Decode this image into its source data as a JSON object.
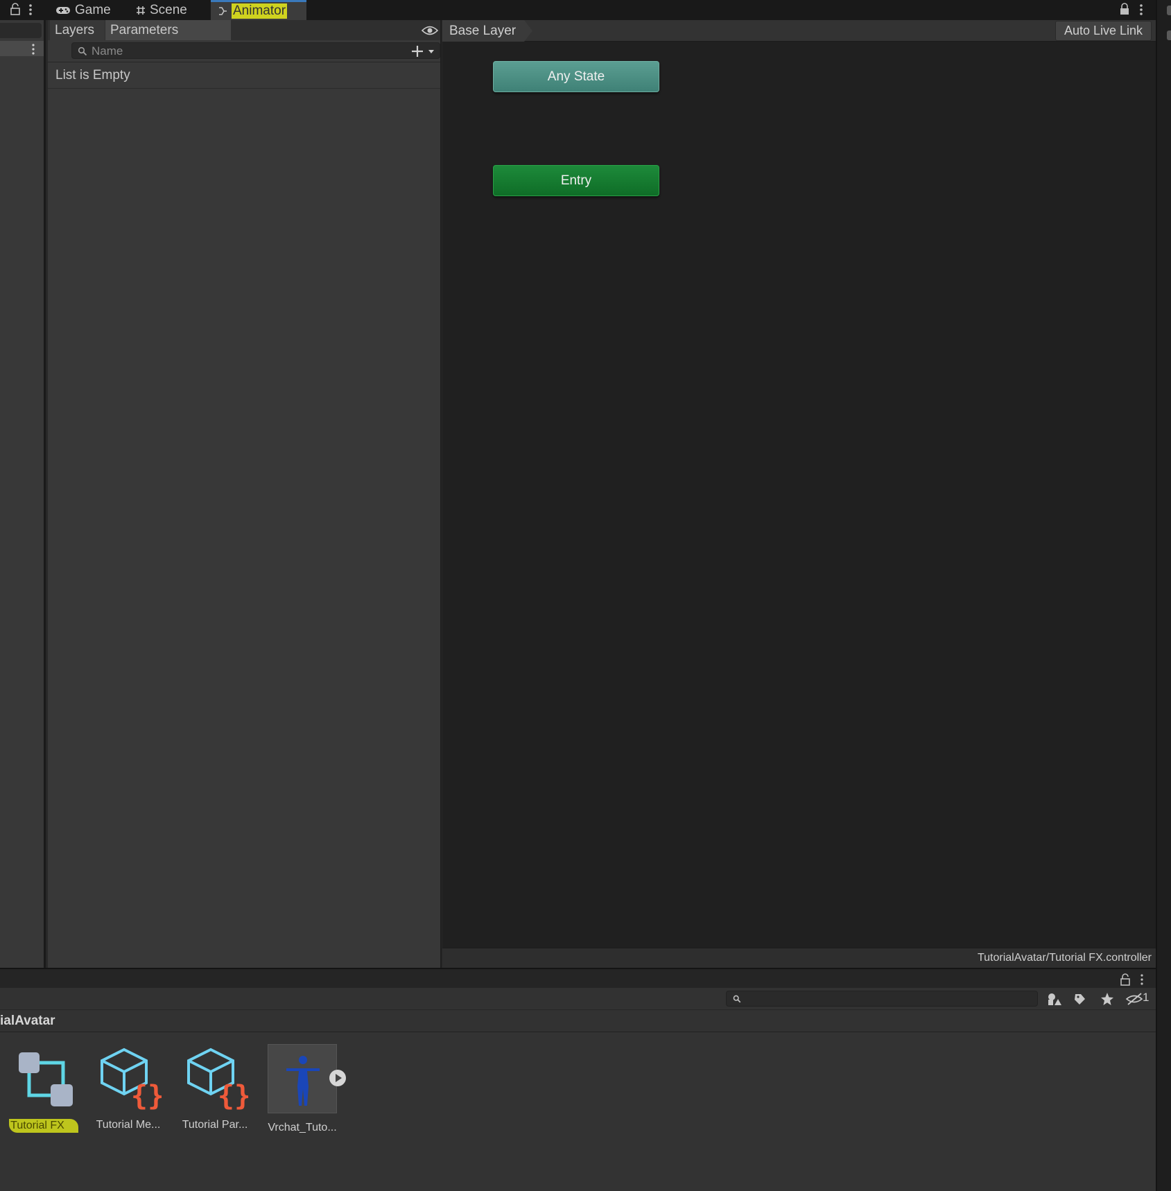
{
  "tabs": [
    {
      "label": "Game",
      "icon": "gamepad-icon"
    },
    {
      "label": "Scene",
      "icon": "grid-hash-icon"
    },
    {
      "label": "Animator",
      "icon": "animator-icon",
      "active": true,
      "highlighted": true
    }
  ],
  "parameters_panel": {
    "tabs": [
      "Layers",
      "Parameters"
    ],
    "active_tab": "Parameters",
    "search_placeholder": "Name",
    "empty_text": "List is Empty"
  },
  "graph": {
    "breadcrumb": "Base Layer",
    "auto_live_link": "Auto Live Link",
    "nodes": {
      "any_state": "Any State",
      "entry": "Entry"
    },
    "controller_path": "TutorialAvatar/Tutorial FX.controller"
  },
  "project": {
    "breadcrumb": "ialAvatar",
    "search_placeholder": "",
    "hidden_count": "1",
    "assets": [
      {
        "label": "Tutorial FX",
        "icon": "animator-controller-icon",
        "highlighted": true
      },
      {
        "label": "Tutorial Me...",
        "icon": "scriptable-object-icon"
      },
      {
        "label": "Tutorial Par...",
        "icon": "scriptable-object-icon"
      },
      {
        "label": "Vrchat_Tuto...",
        "icon": "avatar-model-icon"
      }
    ]
  },
  "colors": {
    "highlight": "#cfd21f",
    "any_state_node": "#4a8c80",
    "entry_node": "#167a31",
    "active_tab_accent": "#3a79bb"
  }
}
